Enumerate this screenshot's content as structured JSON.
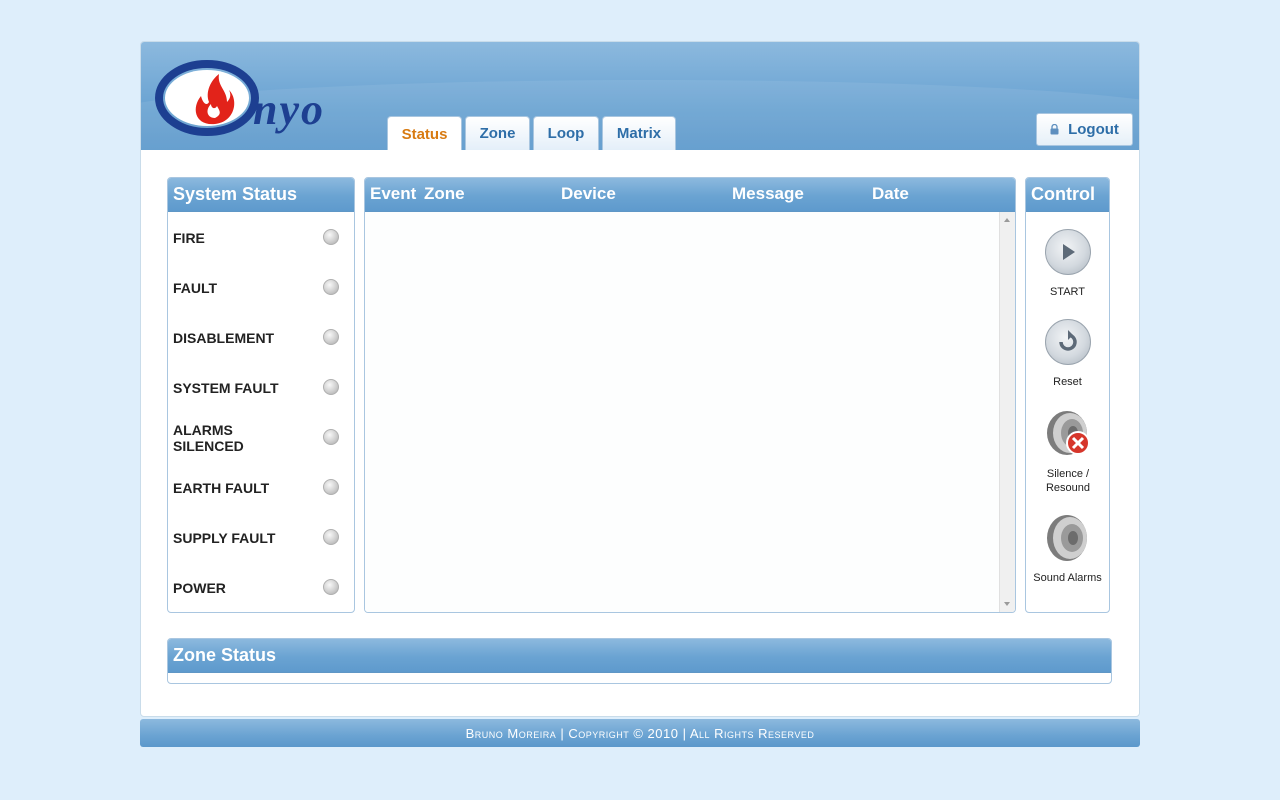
{
  "header": {
    "logo_text": "nyo",
    "tabs": [
      {
        "label": "Status",
        "active": true
      },
      {
        "label": "Zone",
        "active": false
      },
      {
        "label": "Loop",
        "active": false
      },
      {
        "label": "Matrix",
        "active": false
      }
    ],
    "logout_label": "Logout"
  },
  "system_status": {
    "title": "System Status",
    "items": [
      {
        "label": "FIRE",
        "led": "off"
      },
      {
        "label": "FAULT",
        "led": "off"
      },
      {
        "label": "DISABLEMENT",
        "led": "off"
      },
      {
        "label": "SYSTEM FAULT",
        "led": "off"
      },
      {
        "label": "ALARMS SILENCED",
        "led": "off"
      },
      {
        "label": "EARTH FAULT",
        "led": "off"
      },
      {
        "label": "SUPPLY FAULT",
        "led": "off"
      },
      {
        "label": "POWER",
        "led": "off"
      }
    ]
  },
  "events": {
    "columns": [
      "Event",
      "Zone",
      "Device",
      "Message",
      "Date"
    ],
    "rows": []
  },
  "control": {
    "title": "Control",
    "buttons": [
      {
        "label": "START",
        "icon": "play-icon"
      },
      {
        "label": "Reset",
        "icon": "reset-icon"
      },
      {
        "label": "Silence / Resound",
        "icon": "speaker-mute-icon"
      },
      {
        "label": "Sound Alarms",
        "icon": "speaker-icon"
      }
    ]
  },
  "zone_status": {
    "title": "Zone Status"
  },
  "footer": {
    "text": "Bruno Moreira | Copyright © 2010 | All Rights Reserved"
  },
  "colors": {
    "accent": "#6aa3d2",
    "tab_active": "#d87b12",
    "logo_blue": "#1d3f91",
    "flame_red": "#e2231a"
  }
}
